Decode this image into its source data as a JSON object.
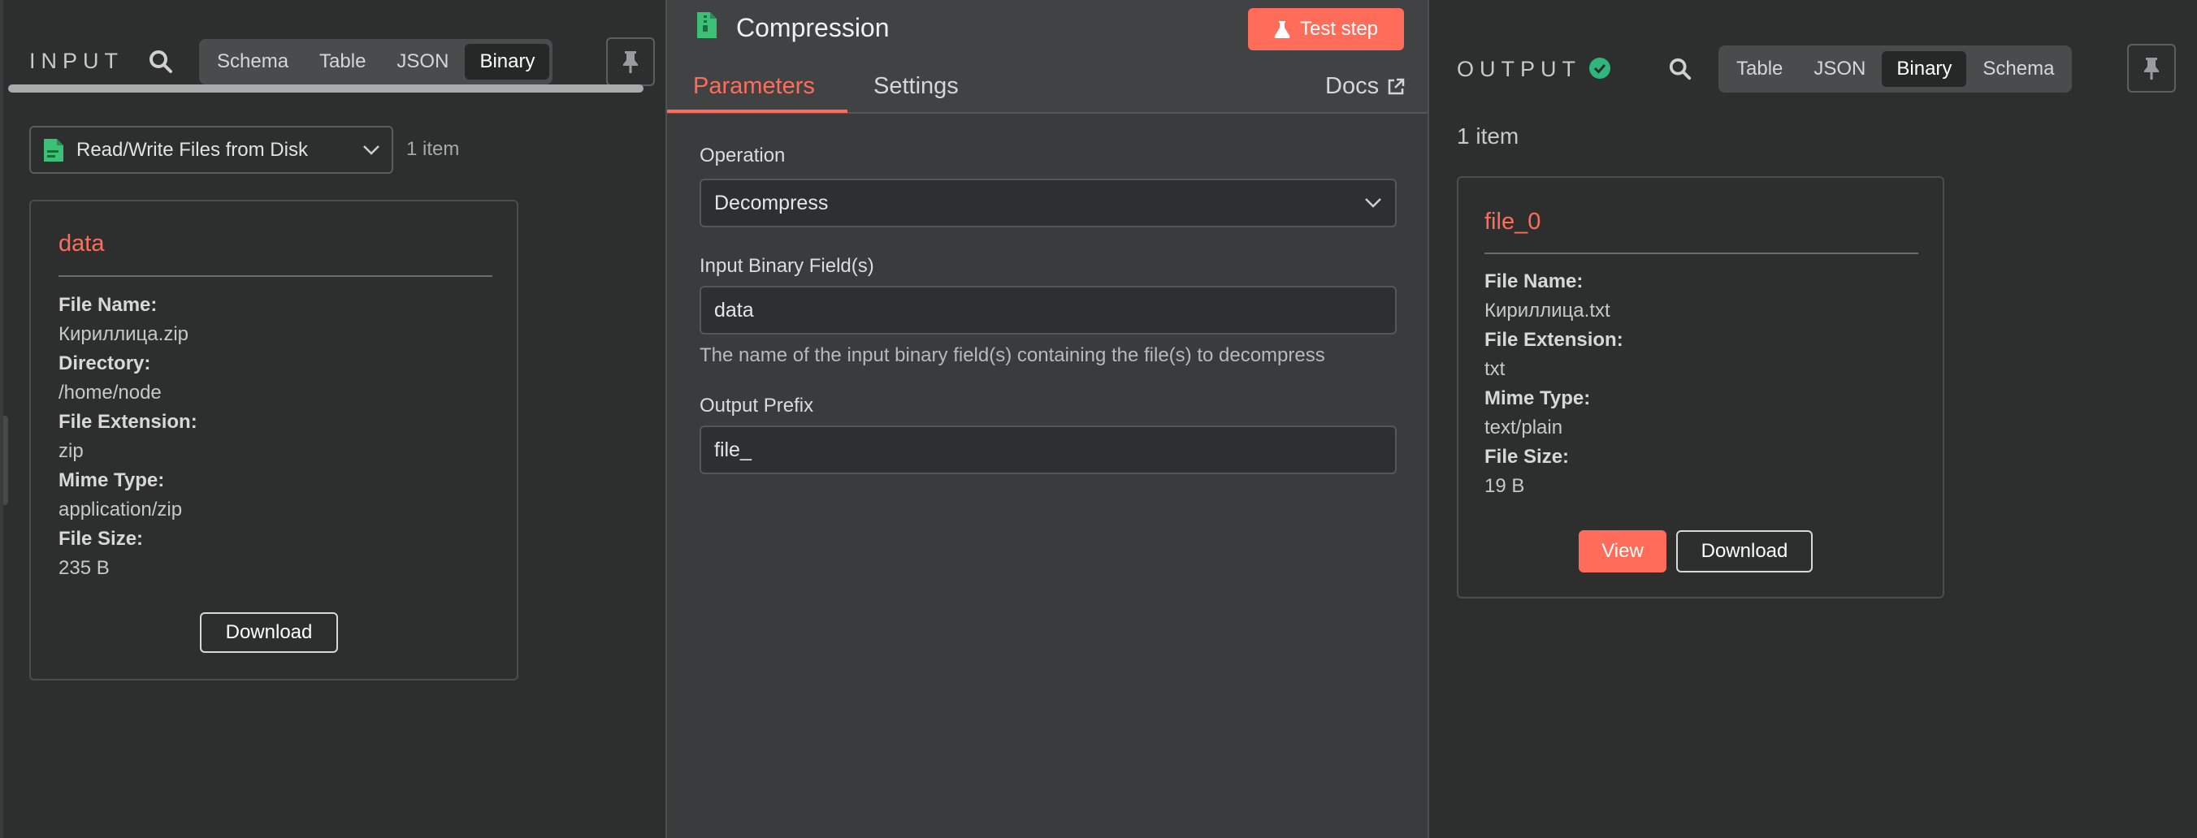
{
  "input": {
    "title": "INPUT",
    "tabs": [
      "Schema",
      "Table",
      "JSON",
      "Binary"
    ],
    "active_tab": "Binary",
    "source_node": "Read/Write Files from Disk",
    "item_count": "1 item",
    "card": {
      "title": "data",
      "fields": [
        {
          "label": "File Name:",
          "value": "Кириллица.zip"
        },
        {
          "label": "Directory:",
          "value": "/home/node"
        },
        {
          "label": "File Extension:",
          "value": "zip"
        },
        {
          "label": "Mime Type:",
          "value": "application/zip"
        },
        {
          "label": "File Size:",
          "value": "235 B"
        }
      ],
      "download_label": "Download"
    }
  },
  "node": {
    "title": "Compression",
    "test_step_label": "Test step",
    "tabs": [
      "Parameters",
      "Settings"
    ],
    "active_tab": "Parameters",
    "docs_label": "Docs",
    "params": {
      "operation_label": "Operation",
      "operation_value": "Decompress",
      "binary_field_label": "Input Binary Field(s)",
      "binary_field_value": "data",
      "binary_field_hint": "The name of the input binary field(s) containing the file(s) to decompress",
      "output_prefix_label": "Output Prefix",
      "output_prefix_value": "file_"
    }
  },
  "output": {
    "title": "OUTPUT",
    "tabs": [
      "Table",
      "JSON",
      "Binary",
      "Schema"
    ],
    "active_tab": "Binary",
    "item_count": "1 item",
    "card": {
      "title": "file_0",
      "fields": [
        {
          "label": "File Name:",
          "value": "Кириллица.txt"
        },
        {
          "label": "File Extension:",
          "value": "txt"
        },
        {
          "label": "Mime Type:",
          "value": "text/plain"
        },
        {
          "label": "File Size:",
          "value": "19 B"
        }
      ],
      "view_label": "View",
      "download_label": "Download"
    }
  },
  "colors": {
    "accent": "#ff6d5a",
    "success": "#2fb67c",
    "node_icon": "#3dbf76"
  }
}
